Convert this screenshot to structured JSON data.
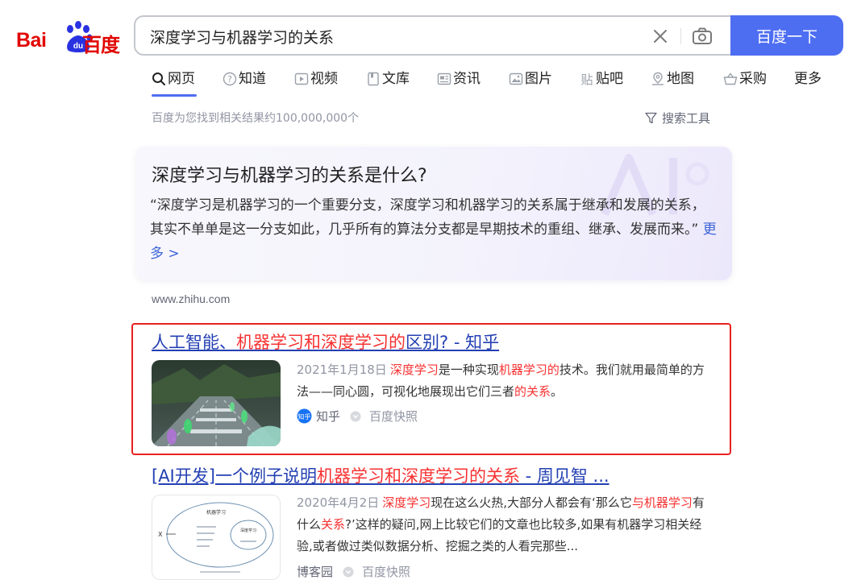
{
  "logo": {
    "latin": "Bai",
    "paw_text": "du",
    "chinese": "百度"
  },
  "search": {
    "query": "深度学习与机器学习的关系",
    "button_label": "百度一下"
  },
  "tabs": [
    {
      "label": "网页",
      "icon": "search-icon",
      "active": true
    },
    {
      "label": "知道",
      "icon": "question-icon"
    },
    {
      "label": "视频",
      "icon": "video-icon"
    },
    {
      "label": "文库",
      "icon": "document-icon"
    },
    {
      "label": "资讯",
      "icon": "news-icon"
    },
    {
      "label": "图片",
      "icon": "image-icon"
    },
    {
      "label": "贴吧",
      "icon": "tieba-icon"
    },
    {
      "label": "地图",
      "icon": "map-icon"
    },
    {
      "label": "采购",
      "icon": "basket-icon"
    },
    {
      "label": "更多"
    }
  ],
  "result_count": "百度为您找到相关结果约100,000,000个",
  "search_tools": "搜索工具",
  "ai_answer": {
    "title": "深度学习与机器学习的关系是什么?",
    "text": "“深度学习是机器学习的一个重要分支，深度学习和机器学习的关系属于继承和发展的关系，其实不单单是这一分支如此，几乎所有的算法分支都是早期技术的重组、继承、发展而来。”",
    "more": "更多 >",
    "source": "www.zhihu.com"
  },
  "results": [
    {
      "title_parts": [
        "人工智能、",
        "机器学习和深度学习的",
        "区别? - 知乎"
      ],
      "date": "2021年1月18日",
      "snippet_parts": [
        "深度学习",
        "是一种实现",
        "机器学习的",
        "技术。我们就用最简单的方法——同心圆，可视化地展现出它们三者",
        "的关系",
        "。"
      ],
      "site": "知乎",
      "site_badge": "知乎",
      "cache": "百度快照"
    },
    {
      "title_parts": [
        "[AI开发]一个例子说明",
        "机器学习和深度学习的关系",
        " - 周见智 ..."
      ],
      "date": "2020年4月2日",
      "snippet_parts": [
        "深度学习",
        "现在这么火热,大部分人都会有‘那么它",
        "与机器学习",
        "有什么",
        "关系",
        "?’这样的疑问,网上比较它们的文章也比较多,如果有机器学习相关经验,或者做过类似数据分析、挖掘之类的人看完那些..."
      ],
      "site": "博客园",
      "cache": "百度快照",
      "thumb_labels": {
        "outer": "机器学习",
        "inner": "深度学习",
        "side": "X"
      }
    }
  ],
  "colors": {
    "brand_red": "#e10601",
    "brand_blue": "#2932e1",
    "button_blue": "#4e6ef2",
    "link_blue": "#2440b3",
    "highlight_red": "#f73131",
    "frame_red": "#e8211e"
  }
}
